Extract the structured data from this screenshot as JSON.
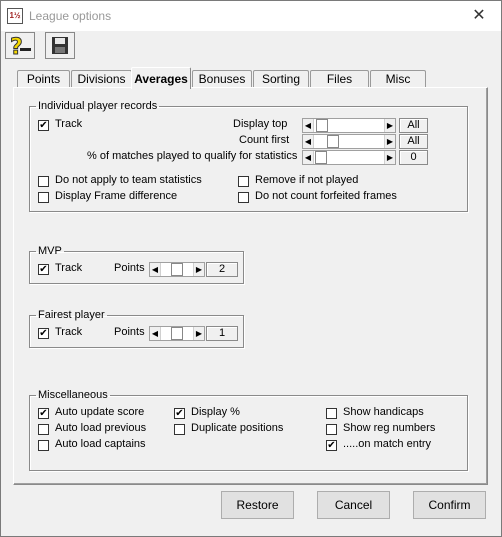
{
  "window": {
    "title": "League options",
    "app_icon_text": "1½"
  },
  "tabs": [
    {
      "label": "Points"
    },
    {
      "label": "Divisions"
    },
    {
      "label": "Averages"
    },
    {
      "label": "Bonuses"
    },
    {
      "label": "Sorting"
    },
    {
      "label": "Files"
    },
    {
      "label": "Misc"
    }
  ],
  "active_tab": "Averages",
  "individual": {
    "legend": "Individual player records",
    "track_label": "Track",
    "track_checked": true,
    "display_top_label": "Display top",
    "display_top_value": "All",
    "count_first_label": "Count first",
    "count_first_value": "All",
    "pct_label": "% of matches played to qualify for statistics",
    "pct_value": "0",
    "opt_no_team_stats": "Do not apply to team statistics",
    "opt_frame_diff": "Display Frame difference",
    "opt_remove_not_played": "Remove if not played",
    "opt_no_forfeited": "Do not count forfeited frames"
  },
  "mvp": {
    "legend": "MVP",
    "track_label": "Track",
    "track_checked": true,
    "points_label": "Points",
    "points_value": "2"
  },
  "fairest": {
    "legend": "Fairest player",
    "track_label": "Track",
    "track_checked": true,
    "points_label": "Points",
    "points_value": "1"
  },
  "misc": {
    "legend": "Miscellaneous",
    "auto_update_score": {
      "label": "Auto update score",
      "checked": true
    },
    "auto_load_previous": {
      "label": "Auto load previous",
      "checked": false
    },
    "auto_load_captains": {
      "label": "Auto load captains",
      "checked": false
    },
    "display_pct": {
      "label": "Display %",
      "checked": true
    },
    "duplicate_positions": {
      "label": "Duplicate positions",
      "checked": false
    },
    "show_handicaps": {
      "label": "Show handicaps",
      "checked": false
    },
    "show_reg_numbers": {
      "label": "Show reg numbers",
      "checked": false
    },
    "on_match_entry": {
      "label": ".....on match entry",
      "checked": true
    }
  },
  "buttons": {
    "restore": "Restore",
    "cancel": "Cancel",
    "confirm": "Confirm"
  },
  "glyphs": {
    "check": "✔",
    "close": "✕",
    "arrow_left": "◀",
    "arrow_right": "▶"
  },
  "colors": {
    "help_icon": "#f5d800",
    "save_icon": "#333333"
  }
}
